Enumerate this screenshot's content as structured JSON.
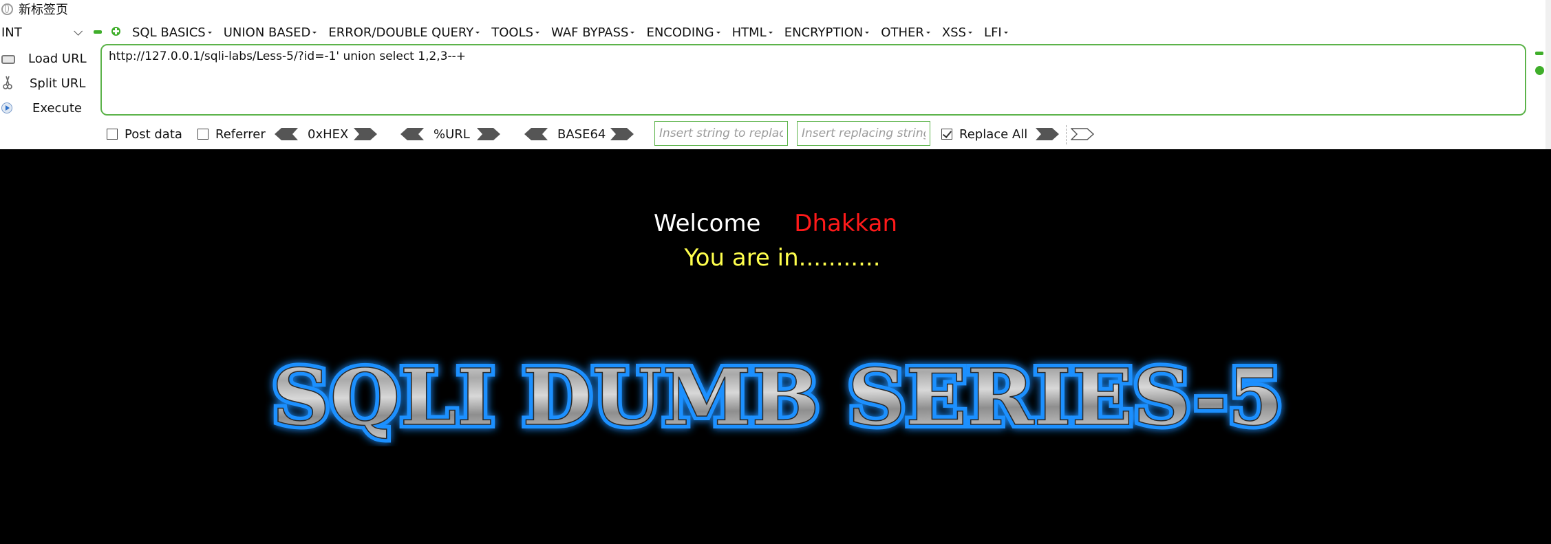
{
  "tab": {
    "title": "新标签页",
    "icon": "globe-icon"
  },
  "toolbar": {
    "int_select": "INT",
    "menu": [
      "SQL BASICS",
      "UNION BASED",
      "ERROR/DOUBLE QUERY",
      "TOOLS",
      "WAF BYPASS",
      "ENCODING",
      "HTML",
      "ENCRYPTION",
      "OTHER",
      "XSS",
      "LFI"
    ],
    "load_url": "Load URL",
    "split_url": "Split URL",
    "execute": "Execute",
    "url": "http://127.0.0.1/sqli-labs/Less-5/?id=-1' union select 1,2,3--+",
    "post_data": "Post data",
    "referrer": "Referrer",
    "hex": "0xHEX",
    "url_enc": "%URL",
    "base64": "BASE64",
    "replace_placeholder": "Insert string to replace",
    "replacing_placeholder": "Insert replacing string",
    "replace_all": "Replace All",
    "replace_all_checked": true,
    "accent_color": "#5cb34a"
  },
  "page": {
    "welcome": "Welcome",
    "user": "Dhakkan",
    "status": "You are in...........",
    "banner": "SQLI DUMB SERIES-5",
    "colors": {
      "background": "#000000",
      "welcome": "#ffffff",
      "user": "#ff1a1a",
      "status": "#ffff4d",
      "banner_glow": "#1e90ff"
    }
  }
}
